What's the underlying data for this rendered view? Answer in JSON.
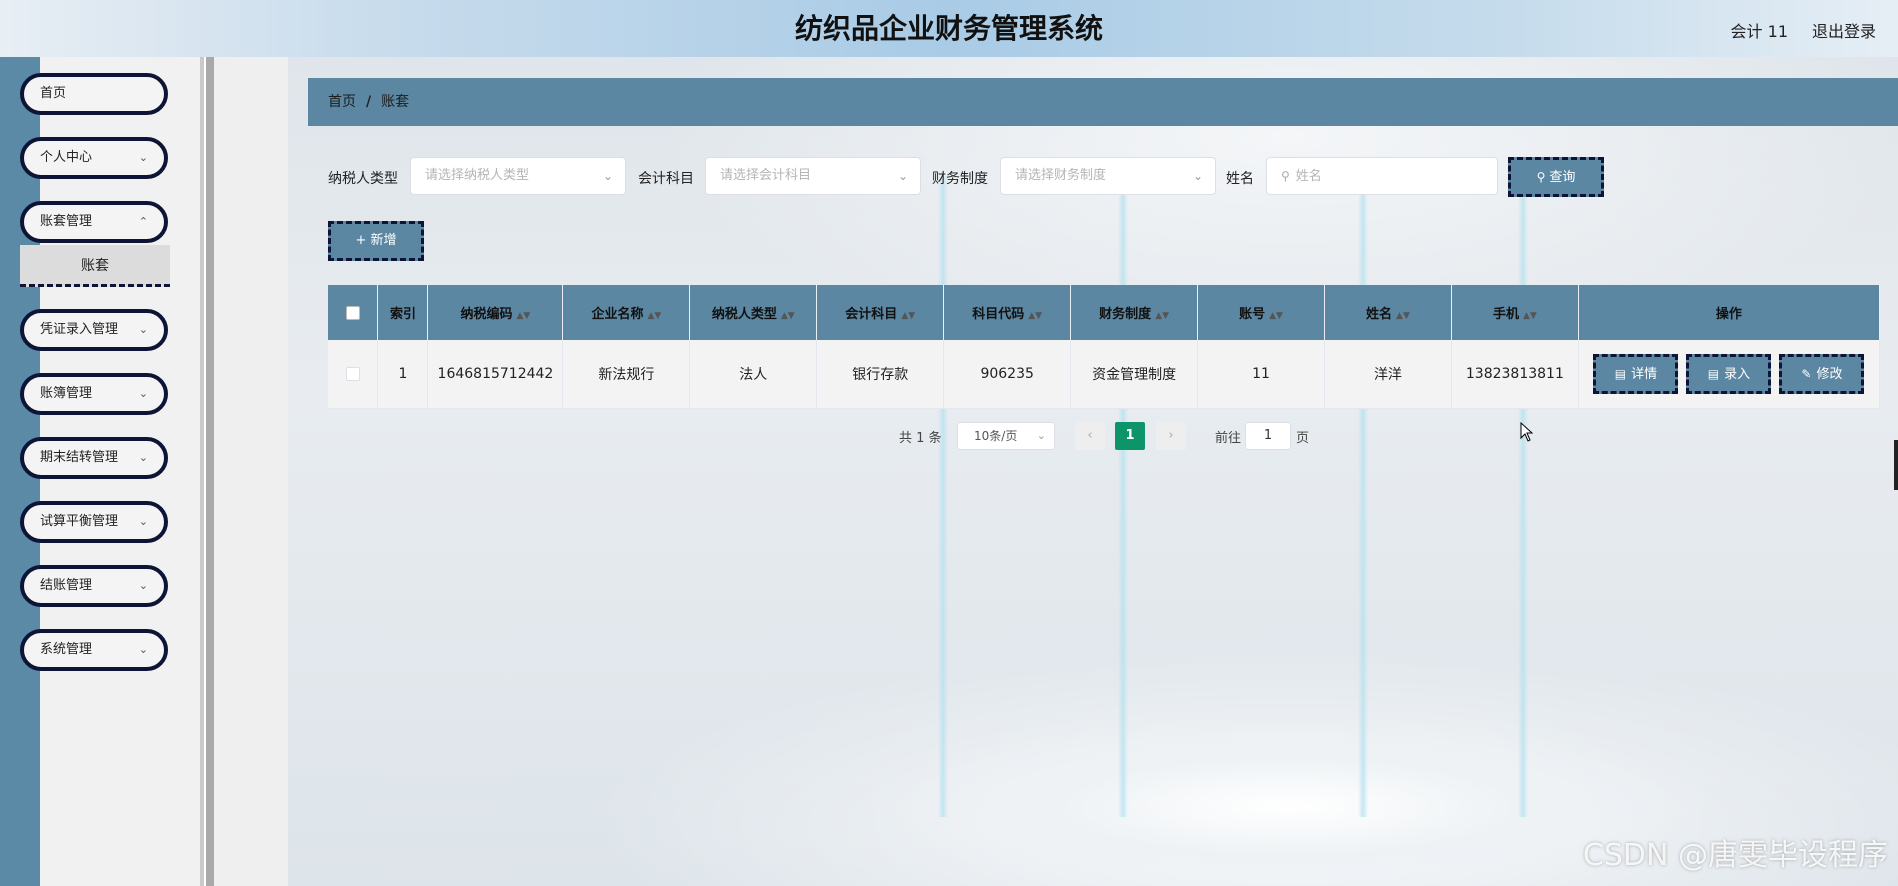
{
  "header": {
    "title": "纺织品企业财务管理系统",
    "user": "会计 11",
    "logout": "退出登录"
  },
  "sidebar": {
    "items": [
      {
        "label": "首页",
        "has_children": false
      },
      {
        "label": "个人中心",
        "has_children": true
      },
      {
        "label": "账套管理",
        "has_children": true
      },
      {
        "label": "凭证录入管理",
        "has_children": true
      },
      {
        "label": "账簿管理",
        "has_children": true
      },
      {
        "label": "期末结转管理",
        "has_children": true
      },
      {
        "label": "试算平衡管理",
        "has_children": true
      },
      {
        "label": "结账管理",
        "has_children": true
      },
      {
        "label": "系统管理",
        "has_children": true
      }
    ],
    "submenu_active": "账套"
  },
  "breadcrumb": {
    "home": "首页",
    "separator": "/",
    "current": "账套"
  },
  "search": {
    "taxpayer_type_label": "纳税人类型",
    "taxpayer_type_placeholder": "请选择纳税人类型",
    "account_subject_label": "会计科目",
    "account_subject_placeholder": "请选择会计科目",
    "finance_system_label": "财务制度",
    "finance_system_placeholder": "请选择财务制度",
    "name_label": "姓名",
    "name_placeholder": "姓名",
    "query_button": "查询",
    "add_button": "新增"
  },
  "table": {
    "headers": [
      "索引",
      "纳税编码",
      "企业名称",
      "纳税人类型",
      "会计科目",
      "科目代码",
      "财务制度",
      "账号",
      "姓名",
      "手机",
      "操作"
    ],
    "rows": [
      {
        "index": "1",
        "tax_code": "1646815712442",
        "company": "新法规行",
        "taxpayer_type": "法人",
        "subject": "银行存款",
        "subject_code": "906235",
        "finance_system": "资金管理制度",
        "account": "11",
        "name": "洋洋",
        "phone": "13823813811"
      }
    ],
    "actions": {
      "detail": "详情",
      "entry": "录入",
      "edit": "修改"
    }
  },
  "pagination": {
    "total_text": "共 1 条",
    "page_size": "10条/页",
    "prev": "‹",
    "current_page": "1",
    "next": "›",
    "goto_prefix": "前往",
    "goto_value": "1",
    "goto_suffix": "页"
  },
  "watermark": "CSDN @唐雯毕设程序",
  "colors": {
    "accent": "#5b87a2",
    "sidebar_border": "#0d1436",
    "pagination_active": "#0d9468"
  }
}
